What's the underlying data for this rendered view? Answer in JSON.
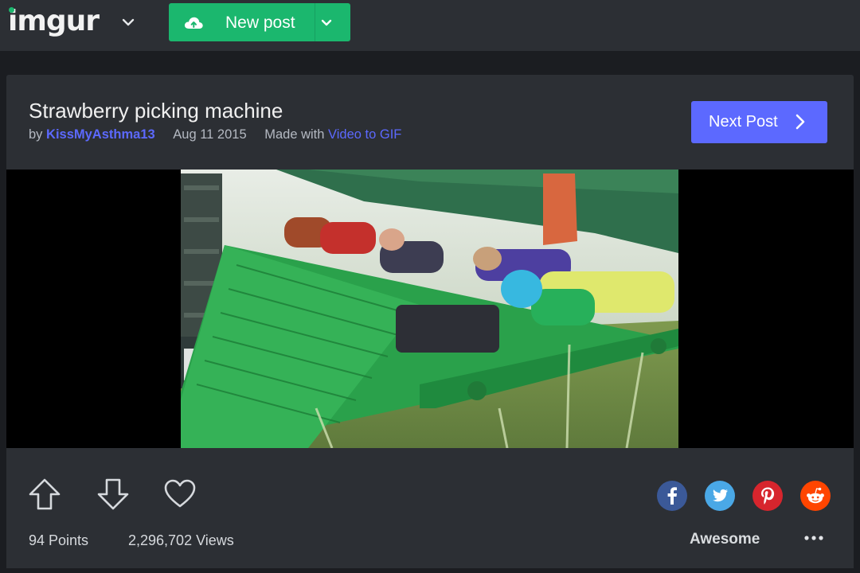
{
  "header": {
    "logo_text": "imgur",
    "new_post_label": "New post",
    "brand_color": "#1bb76e"
  },
  "post": {
    "title": "Strawberry picking machine",
    "by_prefix": "by",
    "author": "KissMyAsthma13",
    "date": "Aug 11 2015",
    "made_with_prefix": "Made with",
    "made_with_link": "Video to GIF",
    "next_post_label": "Next Post",
    "accent_color": "#5c69ff"
  },
  "stats": {
    "points": "94 Points",
    "views": "2,296,702 Views"
  },
  "actions": {
    "icons": [
      "upvote-icon",
      "downvote-icon",
      "favorite-heart-icon"
    ],
    "share": [
      {
        "name": "facebook",
        "color": "#3b5998"
      },
      {
        "name": "twitter",
        "color": "#4aa8e6"
      },
      {
        "name": "pinterest",
        "color": "#d7252d"
      },
      {
        "name": "reddit",
        "color": "#ff4500"
      }
    ],
    "reaction_label": "Awesome",
    "more_icon": "more-dots-icon"
  }
}
